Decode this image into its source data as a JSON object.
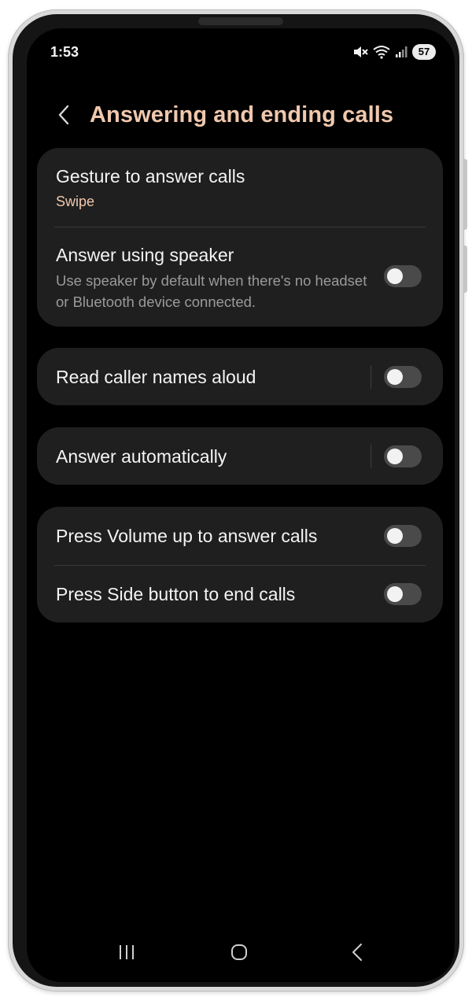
{
  "status_bar": {
    "time": "1:53",
    "battery": "57",
    "icons": [
      "mute-icon",
      "wifi-icon",
      "signal-icon"
    ]
  },
  "header": {
    "title": "Answering and ending calls",
    "back_icon": "chevron-left-icon"
  },
  "settings": {
    "gesture": {
      "title": "Gesture to answer calls",
      "value": "Swipe"
    },
    "speaker": {
      "title": "Answer using speaker",
      "description": "Use speaker by default when there's no headset or Bluetooth device connected.",
      "enabled": false
    },
    "read_names": {
      "title": "Read caller names aloud",
      "enabled": false
    },
    "auto_answer": {
      "title": "Answer automatically",
      "enabled": false
    },
    "volume_up": {
      "title": "Press Volume up to answer calls",
      "enabled": false
    },
    "side_button": {
      "title": "Press Side button to end calls",
      "enabled": false
    }
  },
  "nav_bar": {
    "icons": [
      "recent-apps-icon",
      "home-icon",
      "back-icon"
    ]
  },
  "colors": {
    "accent": "#f0c8ad",
    "card_bg": "#1f1f1f",
    "toggle_off": "#4a4a4a"
  }
}
